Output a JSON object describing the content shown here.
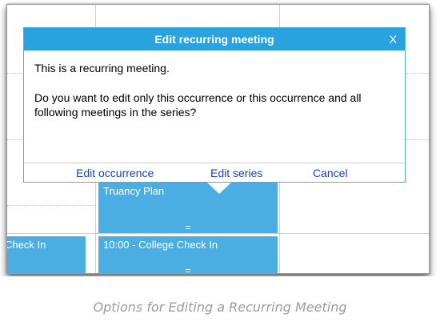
{
  "dialog": {
    "title": "Edit recurring meeting",
    "close_label": "X",
    "message_line1": "This is a recurring meeting.",
    "message_line2": "Do you want to edit only this occurrence or this occurrence and all following meetings in the series?",
    "actions": {
      "edit_occurrence": "Edit occurrence",
      "edit_series": "Edit series",
      "cancel": "Cancel"
    }
  },
  "calendar": {
    "event_truancy": "Truancy Plan",
    "event_checkin_left": "Check In",
    "event_college_checkin": "10:00 - College Check In",
    "resize_handle": "="
  },
  "colors": {
    "dialog_header": "#29a3df",
    "event_fill": "#4aaee2",
    "action_link": "#1d3fc3"
  },
  "caption": "Options for Editing a Recurring Meeting"
}
